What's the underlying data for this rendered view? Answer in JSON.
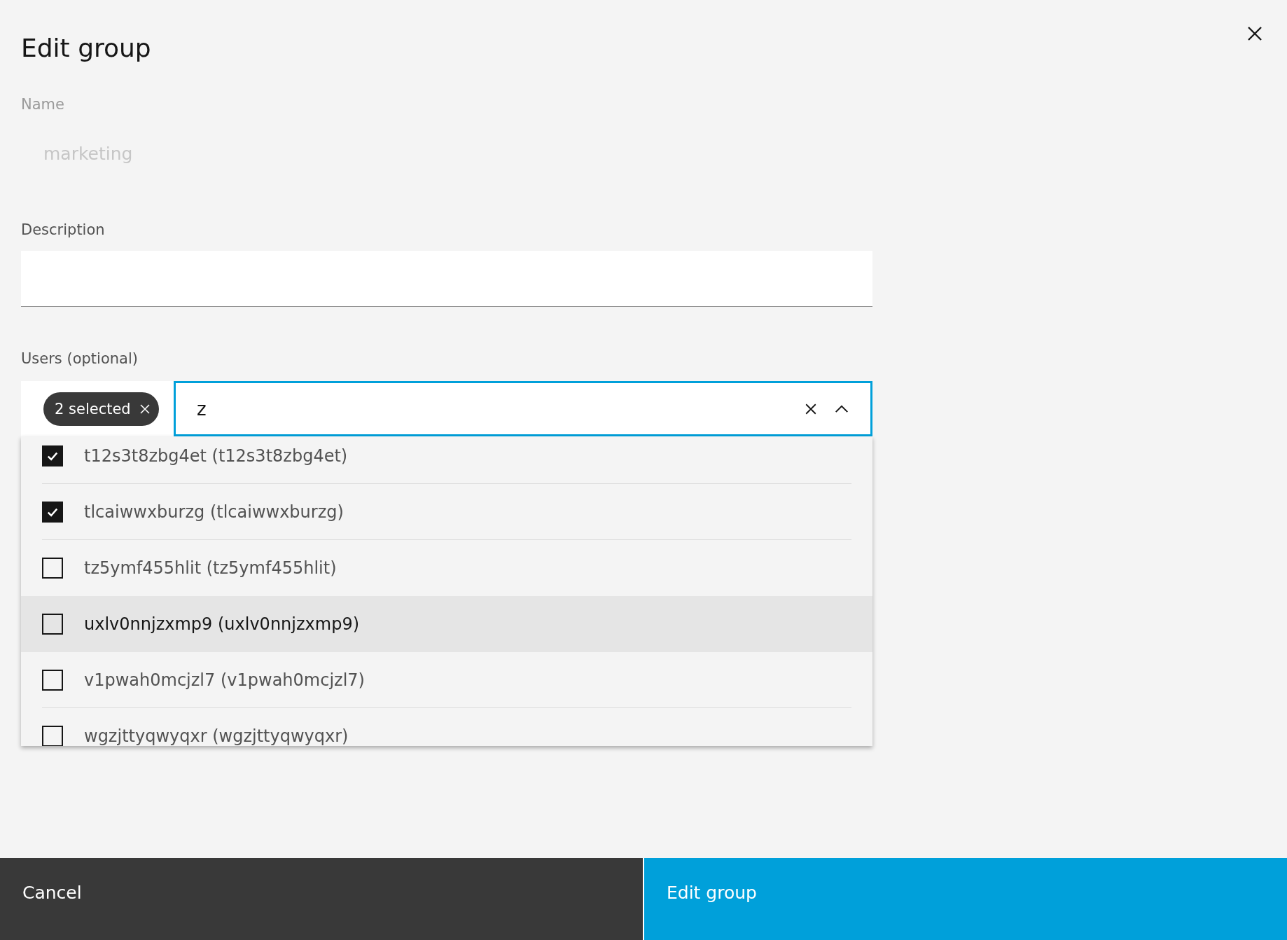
{
  "title": "Edit group",
  "name_field": {
    "label": "Name",
    "value": "marketing",
    "disabled": true
  },
  "description_field": {
    "label": "Description"
  },
  "users_field": {
    "label": "Users (optional)",
    "tag": "2 selected",
    "query": "z",
    "open": true,
    "options": [
      {
        "label": "t12s3t8zbg4et (t12s3t8zbg4et)",
        "checked": true,
        "highlighted": false
      },
      {
        "label": "tlcaiwwxburzg (tlcaiwwxburzg)",
        "checked": true,
        "highlighted": false
      },
      {
        "label": "tz5ymf455hlit (tz5ymf455hlit)",
        "checked": false,
        "highlighted": false
      },
      {
        "label": "uxlv0nnjzxmp9 (uxlv0nnjzxmp9)",
        "checked": false,
        "highlighted": true
      },
      {
        "label": "v1pwah0mcjzl7 (v1pwah0mcjzl7)",
        "checked": false,
        "highlighted": false
      },
      {
        "label": "wgzjttyqwyqxr (wgzjttyqwyqxr)",
        "checked": false,
        "highlighted": false
      }
    ]
  },
  "buttons": [
    {
      "label": "Cancel",
      "kind": "secondary"
    },
    {
      "label": "Edit group",
      "kind": "primary"
    }
  ]
}
